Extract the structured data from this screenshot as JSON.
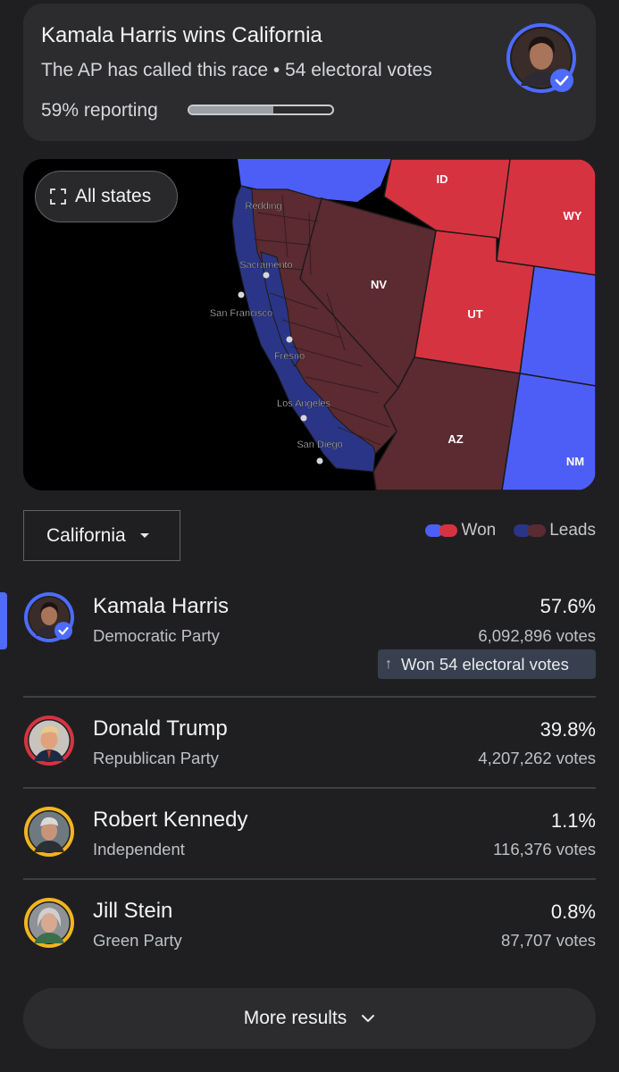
{
  "header": {
    "title": "Kamala Harris wins California",
    "subtitle": "The AP has called this race • 54 electoral votes",
    "reporting_label": "59% reporting",
    "reporting_fraction": 0.59
  },
  "map": {
    "all_states_label": "All states",
    "state_labels": [
      "ID",
      "WY",
      "NV",
      "UT",
      "AZ",
      "NM"
    ],
    "city_labels": [
      "Redding",
      "Sacramento",
      "San Francisco",
      "Fresno",
      "Los Angeles",
      "San Diego"
    ]
  },
  "colors": {
    "dem_won": "#4d5ef7",
    "rep_won": "#d63341",
    "dem_lead": "#2a3587",
    "rep_lead": "#5c2a31",
    "background": "#1f1f21",
    "card": "#2c2c2f"
  },
  "state_selector": {
    "selected": "California"
  },
  "legend": {
    "won_label": "Won",
    "leads_label": "Leads"
  },
  "candidates": [
    {
      "name": "Kamala Harris",
      "party": "Democratic Party",
      "percent": "57.6%",
      "votes": "6,092,896 votes",
      "ring_color": "#4d6bfe",
      "winner": true
    },
    {
      "name": "Donald Trump",
      "party": "Republican Party",
      "percent": "39.8%",
      "votes": "4,207,262 votes",
      "ring_color": "#d63341"
    },
    {
      "name": "Robert Kennedy",
      "party": "Independent",
      "percent": "1.1%",
      "votes": "116,376 votes",
      "ring_color": "#f2b51d"
    },
    {
      "name": "Jill Stein",
      "party": "Green Party",
      "percent": "0.8%",
      "votes": "87,707 votes",
      "ring_color": "#f2b51d"
    }
  ],
  "won_chip": {
    "label": "Won 54 electoral votes",
    "icon": "arrow-up-icon"
  },
  "more_results": {
    "label": "More results",
    "icon": "chevron-down-icon"
  }
}
